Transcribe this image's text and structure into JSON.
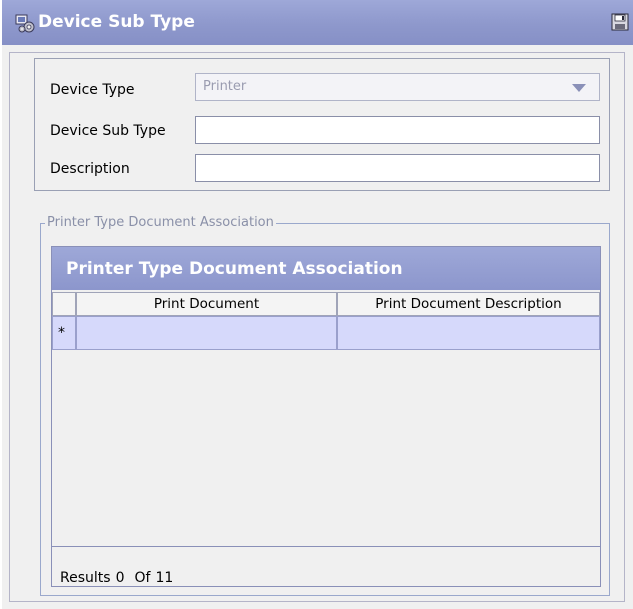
{
  "window": {
    "title": "Device Sub Type",
    "icons": {
      "app": "device-cogs-icon",
      "save": "save-icon"
    }
  },
  "form": {
    "device_type_label": "Device Type",
    "device_type_value": "Printer",
    "device_sub_type_label": "Device Sub Type",
    "device_sub_type_value": "",
    "description_label": "Description",
    "description_value": ""
  },
  "association": {
    "group_label": "Printer Type Document Association",
    "panel_title": "Printer Type Document Association",
    "columns": [
      "Print Document",
      "Print Document Description"
    ],
    "new_row_marker": "*",
    "results": {
      "label": "Results",
      "shown": "0",
      "of_label": "Of",
      "total": "11"
    }
  },
  "colors": {
    "title_bar": "#8e98cc",
    "selected_row": "#d6d9fb",
    "background": "#f0f0f0"
  }
}
